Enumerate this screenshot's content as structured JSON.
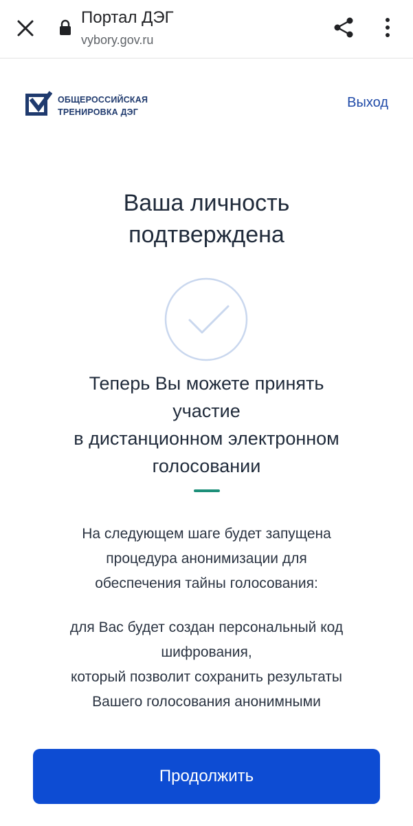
{
  "browser": {
    "title": "Портал ДЭГ",
    "url": "vybory.gov.ru",
    "close_icon": "close-icon",
    "lock_icon": "lock-icon",
    "share_icon": "share-icon",
    "more_icon": "more-vertical-icon"
  },
  "header": {
    "logo_line1": "Общероссийская",
    "logo_line2": "тренировка ДЭГ",
    "logout_label": "Выход"
  },
  "main": {
    "heading_line1": "Ваша личность",
    "heading_line2": "подтверждена",
    "subheading_line1": "Теперь Вы можете принять",
    "subheading_line2": "участие",
    "subheading_line3": "в дистанционном электронном",
    "subheading_line4": "голосовании",
    "para1_line1": "На следующем шаге будет запущена",
    "para1_line2": "процедура анонимизации для",
    "para1_line3": "обеспечения тайны голосования:",
    "para2_line1": "для Вас будет создан персональный код",
    "para2_line2": "шифрования,",
    "para2_line3": "который позволит сохранить результаты",
    "para2_line4": "Вашего голосования анонимными",
    "continue_label": "Продолжить"
  },
  "colors": {
    "brand_blue": "#0d4cd3",
    "logo_blue": "#1f3a6e",
    "accent_green": "#1d8f79",
    "check_circle": "#c9d7ee"
  }
}
